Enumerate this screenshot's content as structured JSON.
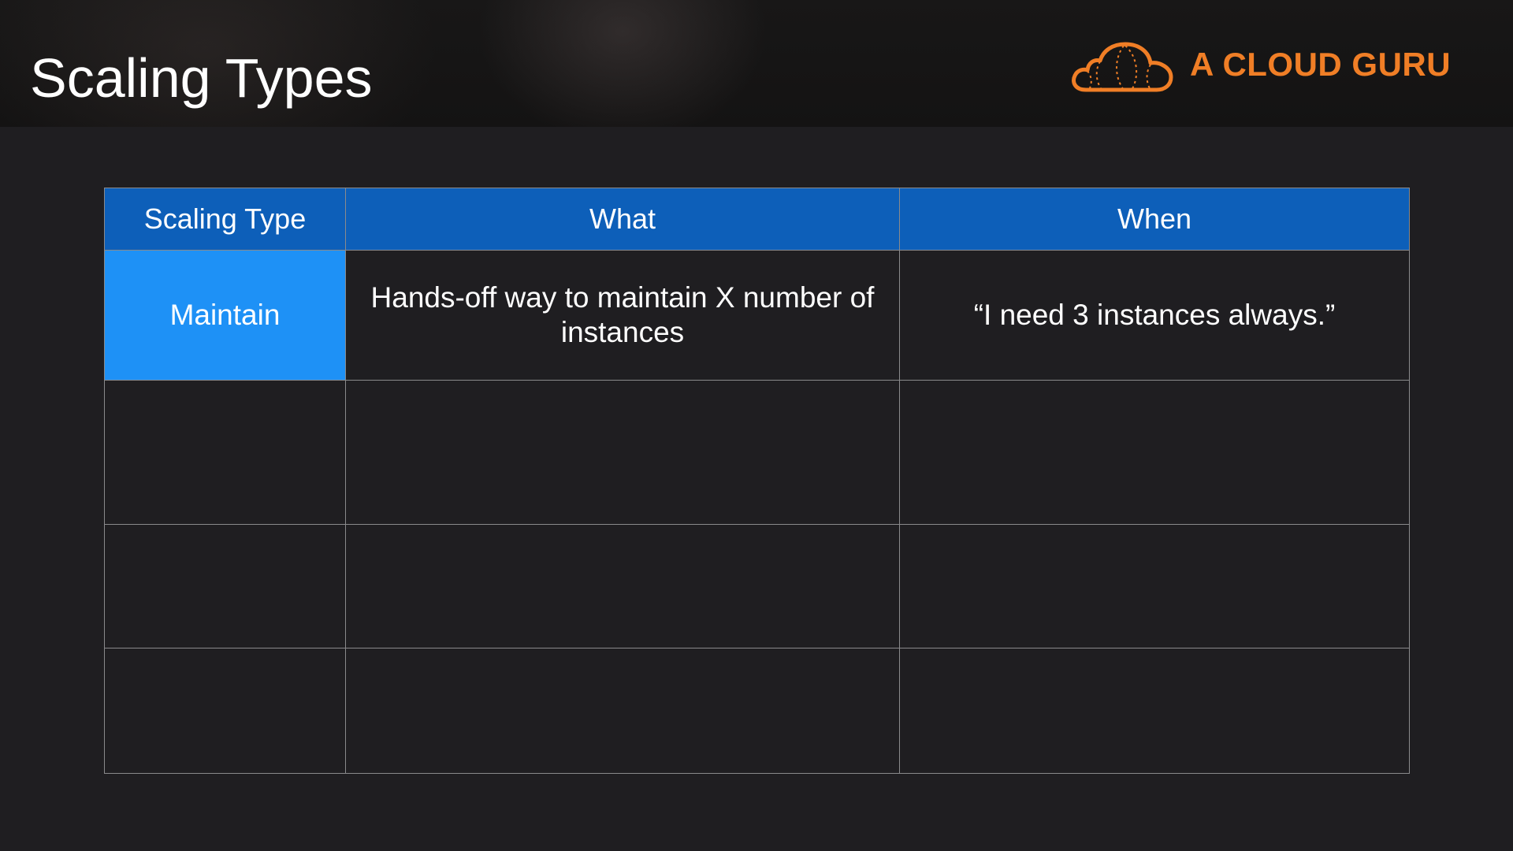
{
  "slide": {
    "title": "Scaling Types"
  },
  "brand": {
    "name": "A CLOUD GURU",
    "logo_icon": "cloud-logo-icon",
    "color": "#f07e26"
  },
  "table": {
    "headers": [
      "Scaling Type",
      "What",
      "When"
    ],
    "rows": [
      {
        "type": "Maintain",
        "what": "Hands-off way to maintain X number of instances",
        "when": "“I need 3 instances always.”"
      },
      {
        "type": "",
        "what": "",
        "when": ""
      },
      {
        "type": "",
        "what": "",
        "when": ""
      },
      {
        "type": "",
        "what": "",
        "when": ""
      }
    ],
    "colors": {
      "header_background": "#0d5fb9",
      "highlight_background": "#1e91f6",
      "body_background": "#1f1e21",
      "grid_lines": "#8a8a8c"
    }
  }
}
